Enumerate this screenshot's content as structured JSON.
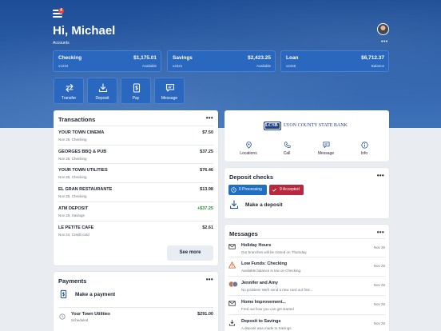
{
  "header": {
    "greeting": "Hi, Michael",
    "notification_count": "4",
    "accounts_label": "Accounts",
    "more": "•••"
  },
  "accounts": [
    {
      "name": "Checking",
      "number": "x1234",
      "amount": "$1,175.01",
      "sub": "Available"
    },
    {
      "name": "Savings",
      "number": "x4321",
      "amount": "$2,423.25",
      "sub": "Available"
    },
    {
      "name": "Loan",
      "number": "x2345",
      "amount": "$6,712.37",
      "sub": "Balance"
    }
  ],
  "actions": [
    {
      "label": "Transfer",
      "icon": "transfer-icon"
    },
    {
      "label": "Deposit",
      "icon": "deposit-icon"
    },
    {
      "label": "Pay",
      "icon": "pay-icon"
    },
    {
      "label": "Message",
      "icon": "message-icon"
    }
  ],
  "transactions": {
    "title": "Transactions",
    "items": [
      {
        "name": "YOUR TOWN CINEMA",
        "sub": "Nov 25, Checking",
        "amount": "$7.50",
        "positive": false
      },
      {
        "name": "GEORGES BBQ & PUB",
        "sub": "Nov 25, Checking",
        "amount": "$37.25",
        "positive": false
      },
      {
        "name": "YOUR TOWN UTILITIES",
        "sub": "Nov 25, Checking",
        "amount": "$76.46",
        "positive": false
      },
      {
        "name": "EL GRAN RESTAURANTE",
        "sub": "Nov 25, Checking",
        "amount": "$13.98",
        "positive": false
      },
      {
        "name": "ATM DEPOSIT",
        "sub": "Nov 25, Savings",
        "amount": "+$37.25",
        "positive": true
      },
      {
        "name": "LE PETITE CAFE",
        "sub": "Nov 24, Credit card",
        "amount": "$2.61",
        "positive": false
      }
    ],
    "see_more": "See more"
  },
  "bank": {
    "logo_text": "LYON COUNTY STATE BANK",
    "logo_mark": "LCSB",
    "quick_links": [
      {
        "label": "Locations",
        "icon": "location-pin-icon"
      },
      {
        "label": "Call",
        "icon": "phone-icon"
      },
      {
        "label": "Message",
        "icon": "chat-icon"
      },
      {
        "label": "Info",
        "icon": "info-icon"
      }
    ]
  },
  "deposit_checks": {
    "title": "Deposit checks",
    "processing": "0 Processing",
    "accepted": "9 Accepted",
    "make_deposit": "Make a deposit"
  },
  "messages": {
    "title": "Messages",
    "items": [
      {
        "title": "Holiday Hours",
        "sub": "Our branches will be closed on Thursday.",
        "date": "Nov 25",
        "icon": "envelope-icon"
      },
      {
        "title": "Low Funds: Checking",
        "sub": "Available balance is low on Checking.",
        "date": "Nov 25",
        "icon": "warning-icon"
      },
      {
        "title": "Jennifer and Amy",
        "sub": "No problem! We'll send a new card out first...",
        "date": "Nov 25",
        "icon": "avatars-icon"
      },
      {
        "title": "Home Improvement...",
        "sub": "Fred out how you can get started",
        "date": "Nov 25",
        "icon": "envelope-icon"
      },
      {
        "title": "Deposit to Savings",
        "sub": "A deposit was made to Savings",
        "date": "Nov 25",
        "icon": "deposit-icon"
      }
    ]
  },
  "payments": {
    "title": "Payments",
    "make_payment": "Make a payment",
    "items": [
      {
        "name": "Your Town Utilities",
        "sub": "Scheduled",
        "amount": "$291.00"
      }
    ]
  },
  "colors": {
    "brand_blue": "#2a67bf",
    "header_blue": "#1d4d96",
    "processing_blue": "#1f6fc2",
    "accepted_red": "#b8283f",
    "positive_green": "#2e8b3a"
  }
}
